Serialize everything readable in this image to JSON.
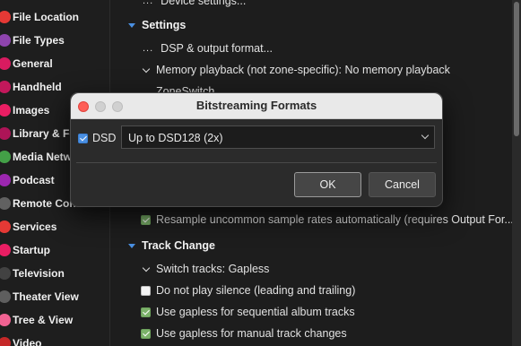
{
  "sidebar": {
    "items": [
      {
        "label": "File Location",
        "color": "#e53935"
      },
      {
        "label": "File Types",
        "color": "#8e44ad"
      },
      {
        "label": "General",
        "color": "#d81b60"
      },
      {
        "label": "Handheld",
        "color": "#c2185b"
      },
      {
        "label": "Images",
        "color": "#e91e63"
      },
      {
        "label": "Library & Fo",
        "color": "#ad1457"
      },
      {
        "label": "Media Netw",
        "color": "#43a047"
      },
      {
        "label": "Podcast",
        "color": "#9c27b0"
      },
      {
        "label": "Remote Control",
        "color": "#616161"
      },
      {
        "label": "Services",
        "color": "#e53935"
      },
      {
        "label": "Startup",
        "color": "#e91e63"
      },
      {
        "label": "Television",
        "color": "#424242"
      },
      {
        "label": "Theater View",
        "color": "#5e5e5e"
      },
      {
        "label": "Tree & View",
        "color": "#f06292"
      },
      {
        "label": "Video",
        "color": "#c62828"
      }
    ]
  },
  "main": {
    "device_settings": "Device settings...",
    "settings_section": "Settings",
    "dsp_output": "DSP & output format...",
    "memory_playback": "Memory playback (not zone-specific): No memory playback",
    "zoneswitch": "ZoneSwitch",
    "resample": "Resample uncommon sample rates automatically (requires Output For...",
    "track_change_section": "Track Change",
    "switch_tracks": "Switch tracks: Gapless",
    "no_silence": "Do not play silence (leading and trailing)",
    "gapless_album": "Use gapless for sequential album tracks",
    "gapless_manual": "Use gapless for manual track changes"
  },
  "dialog": {
    "title": "Bitstreaming Formats",
    "dsd_label": "DSD",
    "dsd_checked": true,
    "format_selected": "Up to DSD128 (2x)",
    "ok_label": "OK",
    "cancel_label": "Cancel"
  },
  "colors": {
    "accent_blue": "#4a90e2",
    "check_green": "#7cb26a",
    "close_red": "#fe5f57"
  }
}
